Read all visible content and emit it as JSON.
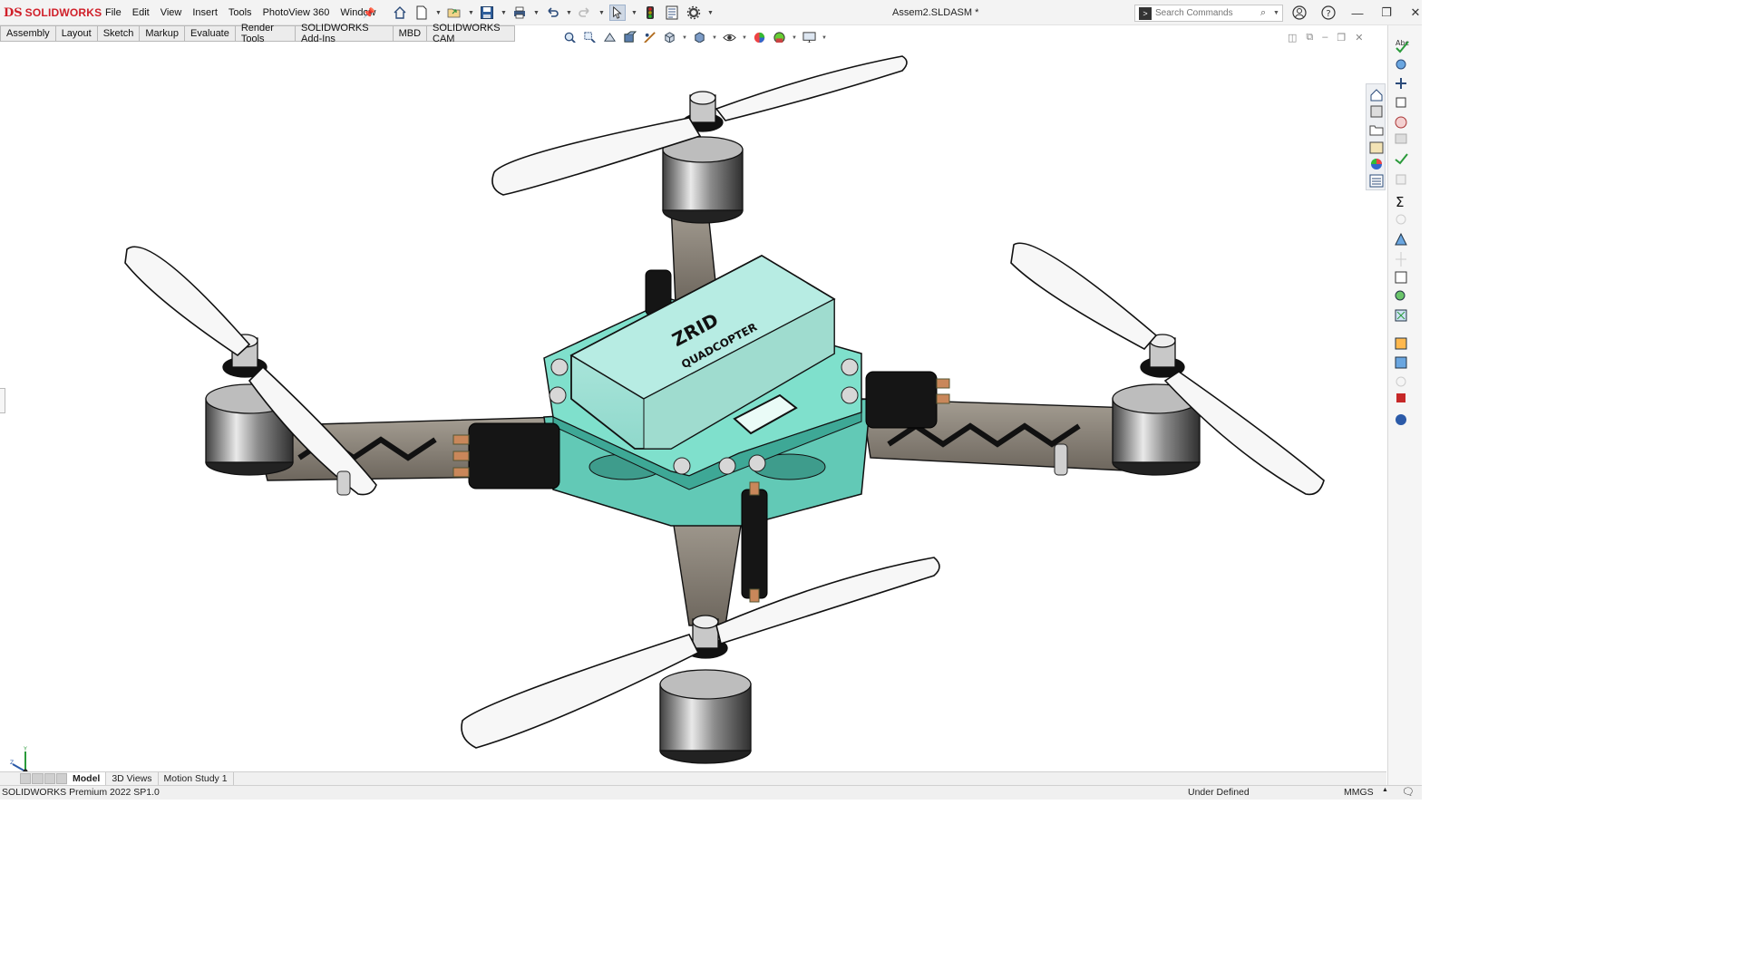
{
  "app": {
    "brand_mark": "DS",
    "brand_name": "SOLIDWORKS"
  },
  "menu": [
    "File",
    "Edit",
    "View",
    "Insert",
    "Tools",
    "PhotoView 360",
    "Window"
  ],
  "quick_access": [
    {
      "icon": "home-icon"
    },
    {
      "icon": "new-document-icon"
    },
    {
      "icon": "open-folder-icon"
    },
    {
      "icon": "save-icon"
    },
    {
      "icon": "print-icon"
    },
    {
      "icon": "undo-icon"
    },
    {
      "icon": "redo-icon"
    },
    {
      "icon": "select-pointer-icon"
    },
    {
      "icon": "rebuild-traffic-light-icon"
    },
    {
      "icon": "file-properties-icon"
    },
    {
      "icon": "options-gear-icon"
    }
  ],
  "document": {
    "title": "Assem2.SLDASM *"
  },
  "search": {
    "placeholder": "Search Commands"
  },
  "command_tabs": [
    "Assembly",
    "Layout",
    "Sketch",
    "Markup",
    "Evaluate",
    "Render Tools",
    "SOLIDWORKS Add-Ins",
    "MBD",
    "SOLIDWORKS CAM"
  ],
  "model": {
    "engraving_line1": "ZRID",
    "engraving_line2": "QUADCOPTER"
  },
  "triad": {
    "y": "Y",
    "x": "X",
    "z": "Z"
  },
  "bottom_tabs": [
    {
      "label": "Model",
      "active": true
    },
    {
      "label": "3D Views",
      "active": false
    },
    {
      "label": "Motion Study 1",
      "active": false
    }
  ],
  "status": {
    "product": "SOLIDWORKS Premium 2022 SP1.0",
    "state": "Under Defined",
    "units": "MMGS"
  },
  "colors": {
    "brand_red": "#d0202a",
    "enclosure_teal": "#a6e6dc",
    "plate_teal": "#6fd2c0",
    "arm_gray": "#8a8277"
  }
}
